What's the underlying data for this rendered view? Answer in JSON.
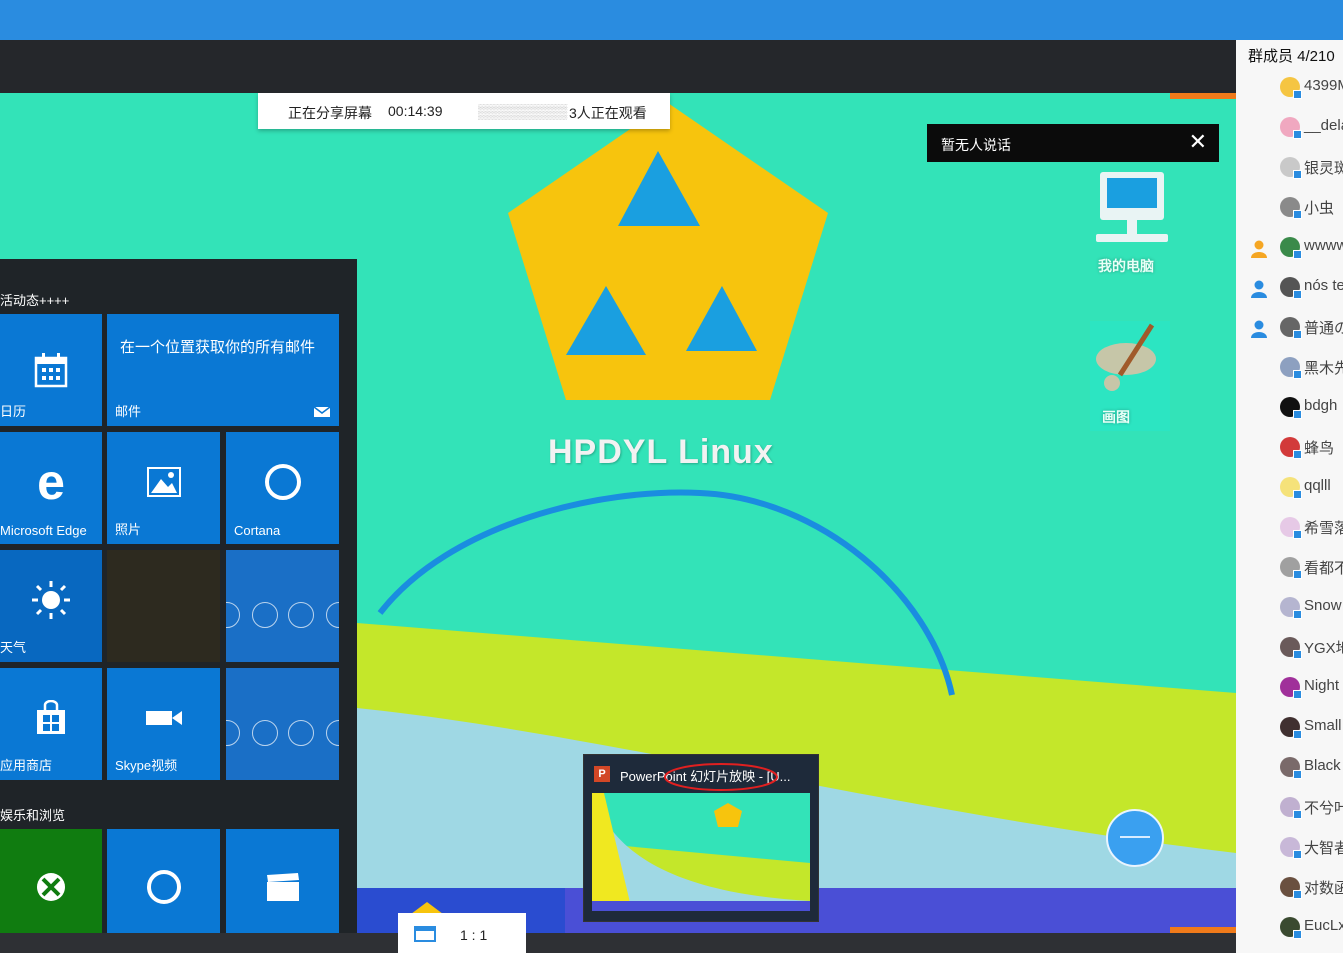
{
  "share_bar": {
    "status": "正在分享屏幕",
    "timer": "00:14:39",
    "viewers": "3人正在观看"
  },
  "chat_toast": {
    "text": "暂无人说话",
    "close": "✕"
  },
  "desktop": {
    "title": "HPDYL Linux",
    "icons": [
      {
        "label": "我的电脑",
        "icon": "computer-icon"
      },
      {
        "label": "画图",
        "icon": "paint-icon"
      }
    ]
  },
  "start_menu": {
    "group1": "活动态++++",
    "group2": "娱乐和浏览",
    "tiles": {
      "calendar": "日历",
      "mail_msg": "在一个位置获取你的所有邮件",
      "mail": "邮件",
      "edge": "Microsoft Edge",
      "photos": "照片",
      "cortana": "Cortana",
      "weather": "天气",
      "store": "应用商店",
      "skype": "Skype视频"
    }
  },
  "preview": {
    "caption": "PowerPoint 幻灯片放映 - [U..."
  },
  "zoom": {
    "ratio": "1 : 1"
  },
  "members": {
    "header": "群成员 4/210",
    "list": [
      {
        "name": "4399M",
        "role": "none",
        "avatar": "#f5c542"
      },
      {
        "name": "__dela",
        "role": "none",
        "avatar": "#f0a8c0"
      },
      {
        "name": "银灵斑",
        "role": "none",
        "avatar": "#c9c9c9"
      },
      {
        "name": "小虫",
        "role": "none",
        "avatar": "#8a8a8a"
      },
      {
        "name": "wwww",
        "role": "owner",
        "avatar": "#3a8a4a"
      },
      {
        "name": "nós te",
        "role": "admin",
        "avatar": "#555555"
      },
      {
        "name": "普通の",
        "role": "admin",
        "avatar": "#666666"
      },
      {
        "name": "黑木先",
        "role": "none",
        "avatar": "#8da0c0"
      },
      {
        "name": "bdgh",
        "role": "none",
        "avatar": "#111111"
      },
      {
        "name": "蜂鸟",
        "role": "none",
        "avatar": "#d23a3a"
      },
      {
        "name": "qqlll",
        "role": "none",
        "avatar": "#f5e27a"
      },
      {
        "name": "希雪落",
        "role": "none",
        "avatar": "#e6c9e6"
      },
      {
        "name": "看都不",
        "role": "none",
        "avatar": "#a0a0a0"
      },
      {
        "name": "Snow",
        "role": "none",
        "avatar": "#b5b5d0"
      },
      {
        "name": "YGX地",
        "role": "none",
        "avatar": "#6a5a5a"
      },
      {
        "name": "Night",
        "role": "none",
        "avatar": "#a0309a"
      },
      {
        "name": "Small",
        "role": "none",
        "avatar": "#403030"
      },
      {
        "name": "Black",
        "role": "none",
        "avatar": "#7a6a6a"
      },
      {
        "name": "不兮叶",
        "role": "none",
        "avatar": "#c0b0d0"
      },
      {
        "name": "大智者",
        "role": "none",
        "avatar": "#c8b8d8"
      },
      {
        "name": "对数函",
        "role": "none",
        "avatar": "#6a5040"
      },
      {
        "name": "EucLx",
        "role": "none",
        "avatar": "#3a4a30"
      }
    ]
  },
  "colors": {
    "topbar": "#2a8ce0",
    "desktop_bg": "#33e3b8",
    "tile_blue": "#0a78d4",
    "pentagon": "#f7c40d"
  }
}
